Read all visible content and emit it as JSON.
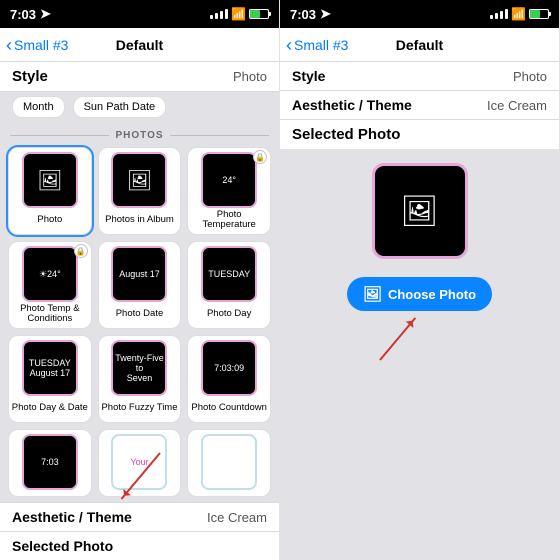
{
  "status": {
    "time": "7:03",
    "signal": 4,
    "wifi": true,
    "battery_pct": 55
  },
  "nav": {
    "back": "Small #3",
    "title": "Default"
  },
  "rows": {
    "style_label": "Style",
    "style_value": "Photo",
    "aesthetic_label": "Aesthetic / Theme",
    "aesthetic_value": "Ice Cream",
    "selected_label": "Selected Photo"
  },
  "chips": {
    "month": "Month",
    "sunpath": "Sun Path Date"
  },
  "section": "PHOTOS",
  "grid": [
    {
      "name": "photo",
      "label": "Photo",
      "glyph": "🖼",
      "locked": false,
      "selected": true
    },
    {
      "name": "in-album",
      "label": "Photos in Album",
      "glyph": "🖼",
      "locked": false
    },
    {
      "name": "temp",
      "label": "Photo Temperature",
      "glyph": "24°",
      "small": true,
      "locked": true
    },
    {
      "name": "temp-cond",
      "label": "Photo Temp & Conditions",
      "glyph": "☀24°",
      "small": true,
      "locked": true
    },
    {
      "name": "date",
      "label": "Photo Date",
      "glyph": "August 17",
      "small": true
    },
    {
      "name": "day",
      "label": "Photo Day",
      "glyph": "TUESDAY",
      "small": true
    },
    {
      "name": "day-date",
      "label": "Photo Day & Date",
      "glyph": "TUESDAY\nAugust 17",
      "small": true
    },
    {
      "name": "fuzzy",
      "label": "Photo Fuzzy Time",
      "glyph": "Twenty-Five\nto\nSeven",
      "small": true
    },
    {
      "name": "countdown",
      "label": "Photo Countdown",
      "glyph": "7:03:09",
      "small": true
    }
  ],
  "gridrow4": [
    {
      "name": "time",
      "glyph": "7:03",
      "small": true
    },
    {
      "name": "extra1",
      "glyph": "Your",
      "small": true,
      "lightborder": true
    },
    {
      "name": "extra2",
      "glyph": "",
      "small": true,
      "lightborder": true
    }
  ],
  "choose": "Choose Photo"
}
